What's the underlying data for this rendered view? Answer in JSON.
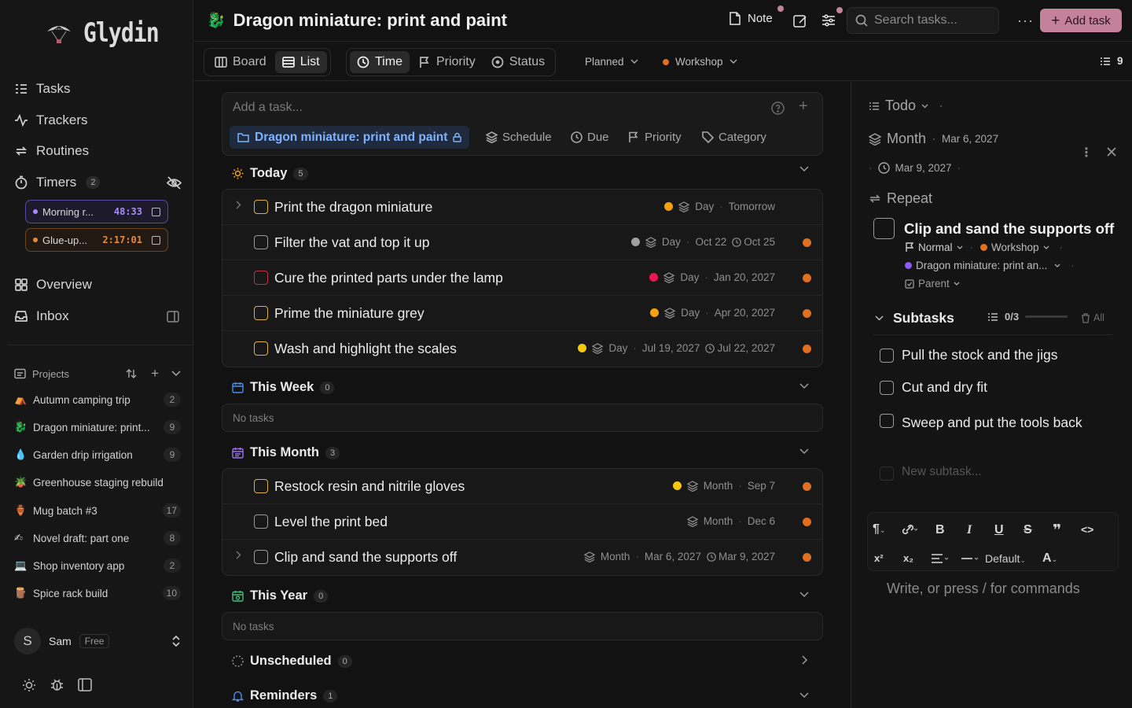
{
  "app": {
    "name": "Glydin"
  },
  "nav": {
    "tasks": "Tasks",
    "trackers": "Trackers",
    "routines": "Routines",
    "timers": "Timers",
    "timers_count": "2",
    "overview": "Overview",
    "inbox": "Inbox"
  },
  "timers": [
    {
      "label": "Morning r...",
      "time": "48:33",
      "color": "#a78bfa"
    },
    {
      "label": "Glue-up...",
      "time": "2:17:01",
      "color": "#e58a3a"
    }
  ],
  "projects_header": "Projects",
  "projects": [
    {
      "emoji": "⛺",
      "name": "Autumn camping trip",
      "count": "2"
    },
    {
      "emoji": "🐉",
      "name": "Dragon miniature: print...",
      "count": "9"
    },
    {
      "emoji": "💧",
      "name": "Garden drip irrigation",
      "count": "9"
    },
    {
      "emoji": "🪴",
      "name": "Greenhouse staging rebuild",
      "count": ""
    },
    {
      "emoji": "🏺",
      "name": "Mug batch #3",
      "count": "17"
    },
    {
      "emoji": "✍",
      "name": "Novel draft: part one",
      "count": "8"
    },
    {
      "emoji": "💻",
      "name": "Shop inventory app",
      "count": "2"
    },
    {
      "emoji": "🪵",
      "name": "Spice rack build",
      "count": "10"
    }
  ],
  "user": {
    "initial": "S",
    "name": "Sam",
    "plan": "Free"
  },
  "header": {
    "title": "Dragon miniature: print and paint",
    "note": "Note",
    "search_placeholder": "Search tasks...",
    "add_task": "Add task"
  },
  "toolbar": {
    "board": "Board",
    "list": "List",
    "time": "Time",
    "priority": "Priority",
    "status": "Status",
    "planned": "Planned",
    "workshop": "Workshop",
    "count": "9"
  },
  "addbox": {
    "placeholder": "Add a task...",
    "project": "Dragon miniature: print and paint",
    "schedule": "Schedule",
    "due": "Due",
    "priority": "Priority",
    "category": "Category"
  },
  "sections": {
    "today": {
      "label": "Today",
      "count": "5"
    },
    "week": {
      "label": "This Week",
      "count": "0"
    },
    "month": {
      "label": "This Month",
      "count": "3"
    },
    "year": {
      "label": "This Year",
      "count": "0"
    },
    "unscheduled": {
      "label": "Unscheduled",
      "count": "0"
    },
    "reminders": {
      "label": "Reminders",
      "count": "1"
    },
    "no_tasks": "No tasks"
  },
  "today_tasks": [
    {
      "title": "Print the dragon miniature",
      "priority_color": "#f5a10c",
      "scope": "Day",
      "date": "Tomorrow",
      "due": "",
      "expand": true,
      "checkbox": "#e0b040",
      "org": false
    },
    {
      "title": "Filter the vat and top it up",
      "priority_color": "#a0a0a0",
      "scope": "Day",
      "date": "Oct 22",
      "due": "Oct 25",
      "expand": false,
      "checkbox": "#9a9a9a",
      "org": true
    },
    {
      "title": "Cure the printed parts under the lamp",
      "priority_color": "#e8174f",
      "scope": "Day",
      "date": "Jan 20, 2027",
      "due": "",
      "expand": false,
      "checkbox": "#c0304a",
      "org": true
    },
    {
      "title": "Prime the miniature grey",
      "priority_color": "#f5a10c",
      "scope": "Day",
      "date": "Apr 20, 2027",
      "due": "",
      "expand": false,
      "checkbox": "#e0b040",
      "org": true
    },
    {
      "title": "Wash and highlight the scales",
      "priority_color": "#f5c80c",
      "scope": "Day",
      "date": "Jul 19, 2027",
      "due": "Jul 22, 2027",
      "expand": false,
      "checkbox": "#e0b040",
      "org": true
    }
  ],
  "month_tasks": [
    {
      "title": "Restock resin and nitrile gloves",
      "priority_color": "#f5c80c",
      "scope": "Month",
      "date": "Sep 7",
      "due": "",
      "expand": false,
      "checkbox": "#e0b040",
      "org": true
    },
    {
      "title": "Level the print bed",
      "priority_color": "",
      "scope": "Month",
      "date": "Dec 6",
      "due": "",
      "expand": false,
      "checkbox": "#9a9a9a",
      "org": true
    },
    {
      "title": "Clip and sand the supports off",
      "priority_color": "",
      "scope": "Month",
      "date": "Mar 6, 2027",
      "due": "Mar 9, 2027",
      "expand": true,
      "checkbox": "#9a9a9a",
      "org": true
    }
  ],
  "panel": {
    "status": "Todo",
    "scope": "Month",
    "scope_date": "Mar 6, 2027",
    "due_date": "Mar 9, 2027",
    "repeat": "Repeat",
    "title": "Clip and sand the supports off",
    "priority": "Normal",
    "category": "Workshop",
    "project": "Dragon miniature: print an...",
    "parent": "Parent",
    "subtasks_label": "Subtasks",
    "subtasks_progress": "0/3",
    "all": "All",
    "subtasks": [
      "Pull the stock and the jigs",
      "Cut and dry fit",
      "Sweep and put the tools back"
    ],
    "new_subtask": "New subtask...",
    "font_default": "Default",
    "editor_placeholder": "Write, or press / for commands"
  },
  "colors": {
    "accent": "#c4829a",
    "project_blue": "#7fb2ff",
    "orange": "#e06f1f"
  }
}
